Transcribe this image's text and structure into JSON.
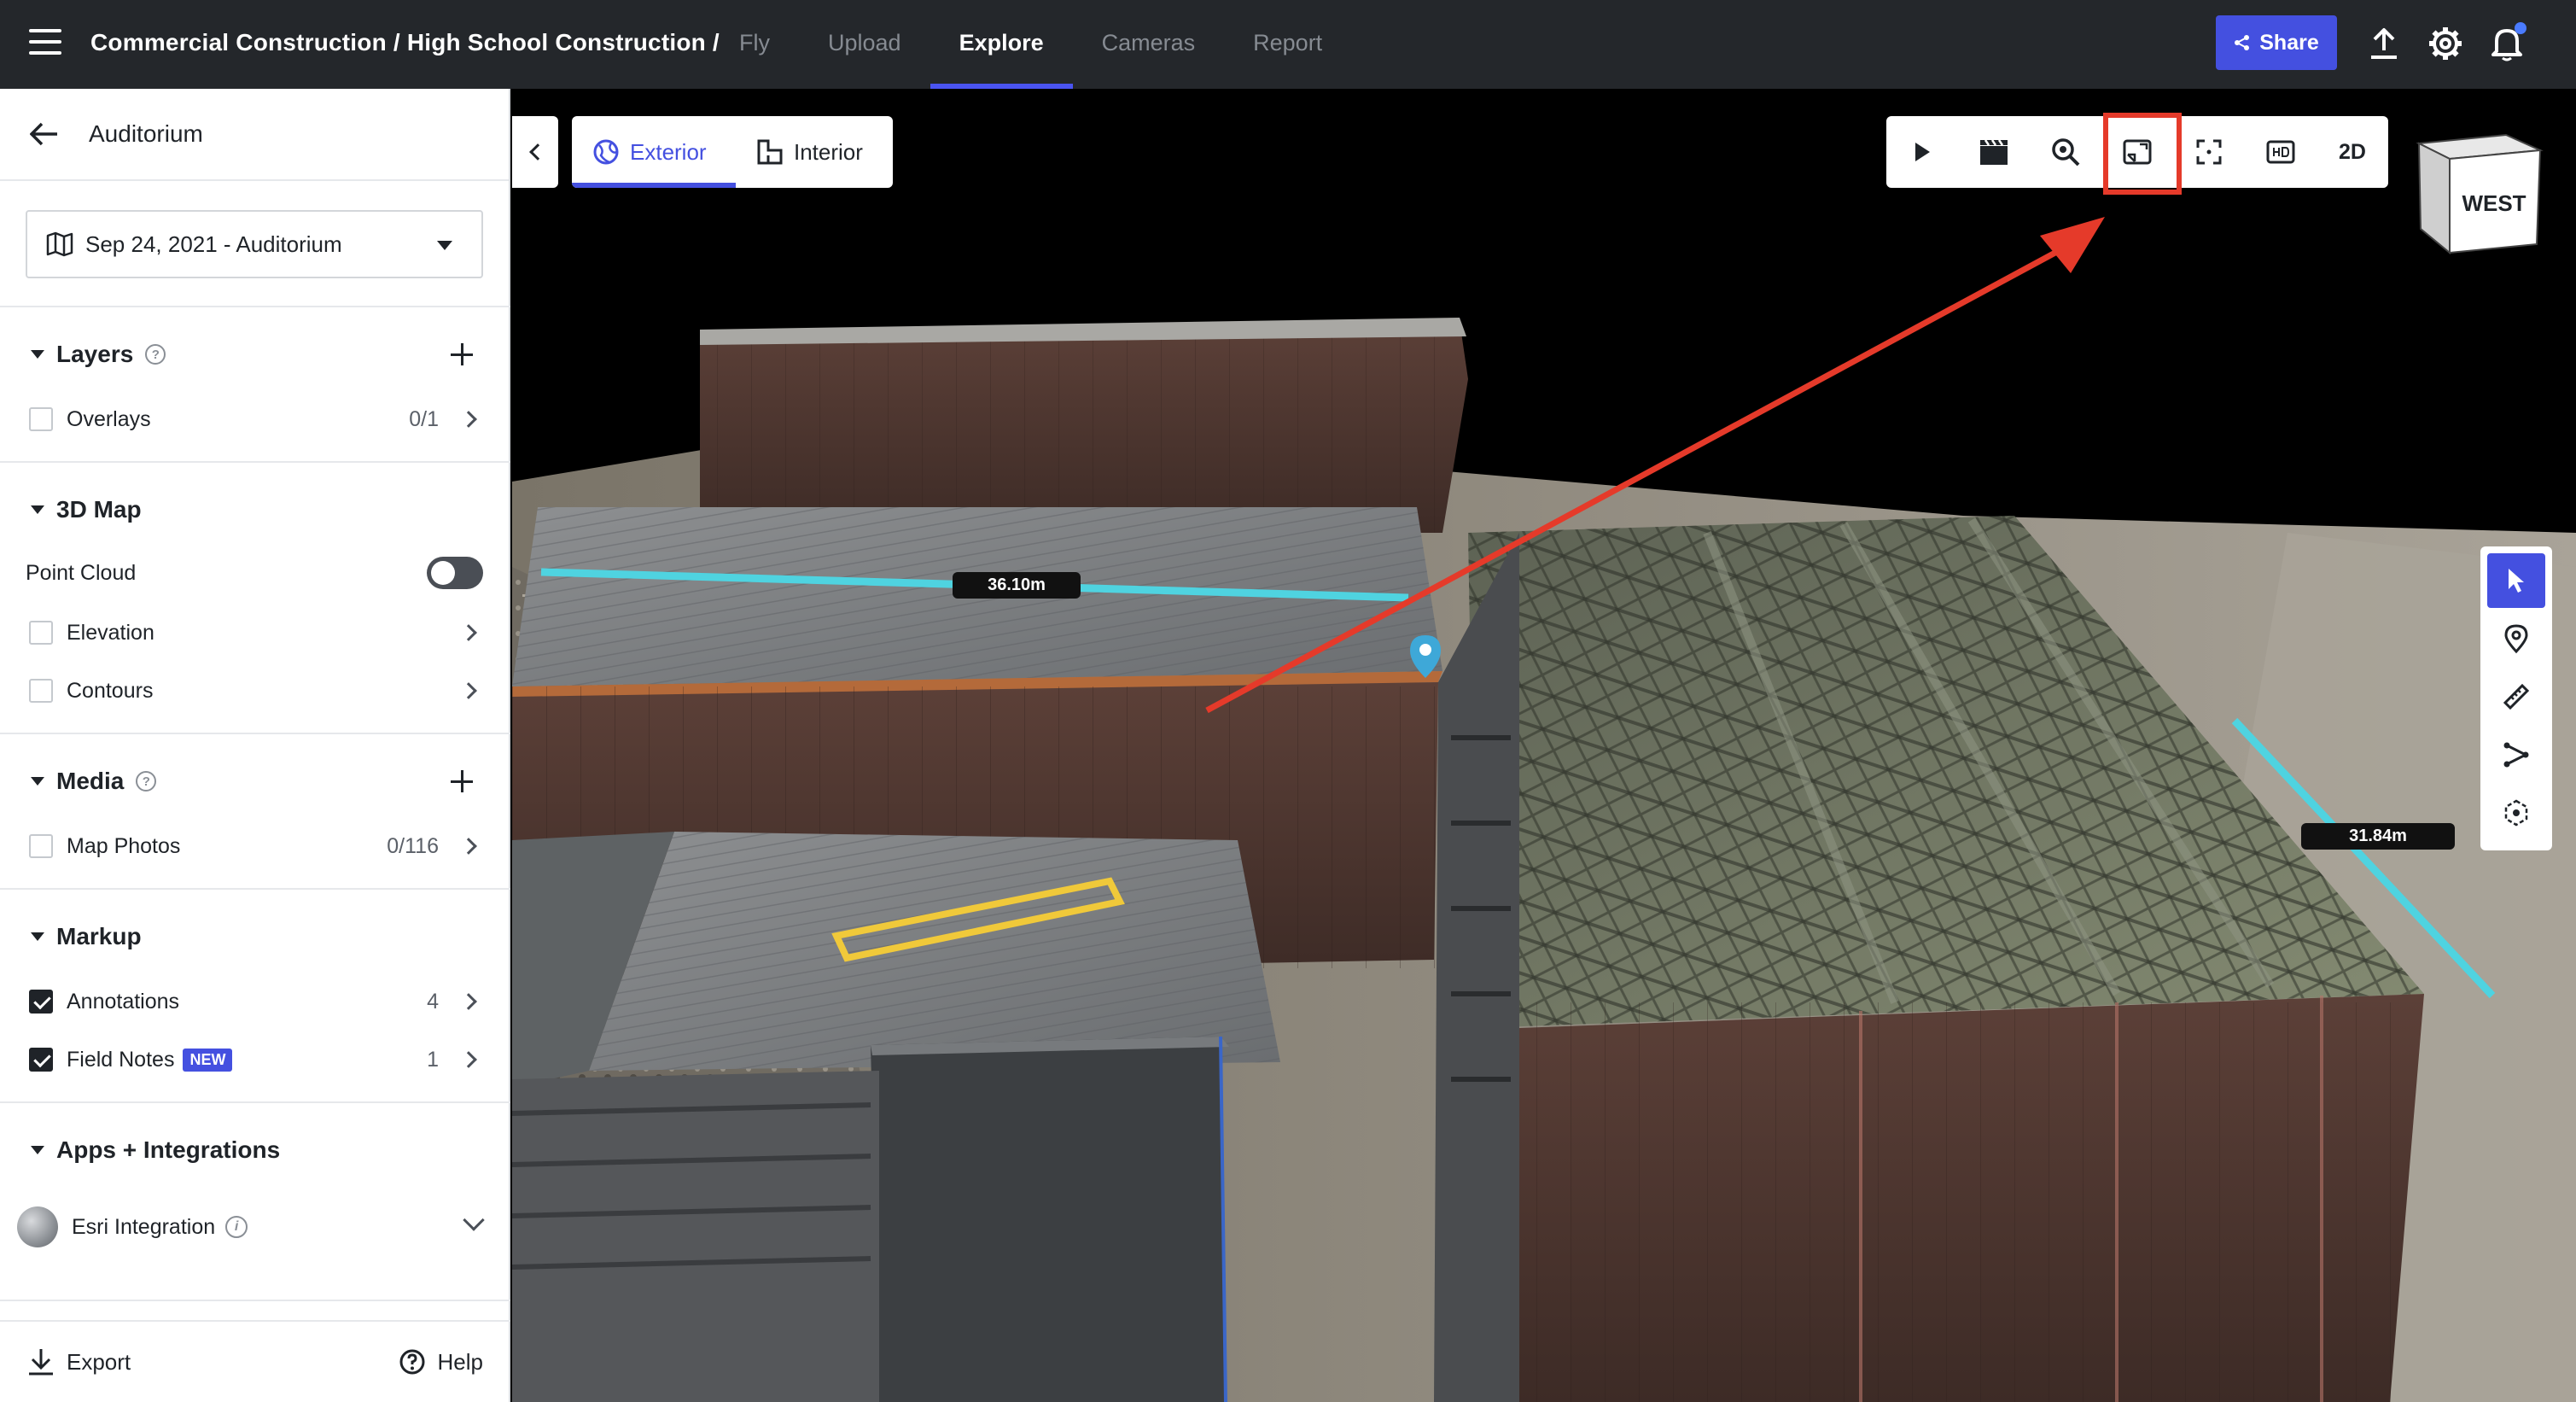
{
  "topbar": {
    "breadcrumb": "Commercial Construction / High School Construction /",
    "tabs": [
      {
        "label": "Fly",
        "active": false
      },
      {
        "label": "Upload",
        "active": false
      },
      {
        "label": "Explore",
        "active": true
      },
      {
        "label": "Cameras",
        "active": false
      },
      {
        "label": "Report",
        "active": false
      }
    ],
    "share_label": "Share",
    "icons": [
      "menu-icon",
      "share-nodes-icon",
      "upload-icon",
      "gear-icon",
      "bell-icon"
    ]
  },
  "sidebar": {
    "title": "Auditorium",
    "date_select": "Sep 24, 2021 - Auditorium",
    "sections": {
      "layers": {
        "label": "Layers",
        "items": [
          {
            "label": "Overlays",
            "count": "0/1",
            "checked": false
          }
        ]
      },
      "map3d": {
        "label": "3D Map",
        "point_cloud": {
          "label": "Point Cloud",
          "enabled": false
        },
        "items": [
          {
            "label": "Elevation",
            "checked": false
          },
          {
            "label": "Contours",
            "checked": false
          }
        ]
      },
      "media": {
        "label": "Media",
        "items": [
          {
            "label": "Map Photos",
            "count": "0/116",
            "checked": false
          }
        ]
      },
      "markup": {
        "label": "Markup",
        "items": [
          {
            "label": "Annotations",
            "count": "4",
            "checked": true
          },
          {
            "label": "Field Notes",
            "count": "1",
            "checked": true,
            "badge": "NEW"
          }
        ]
      },
      "apps": {
        "label": "Apps + Integrations",
        "esri_label": "Esri Integration"
      }
    },
    "footer": {
      "export_label": "Export",
      "help_label": "Help"
    }
  },
  "viewport": {
    "mode_switch": [
      {
        "label": "Exterior",
        "active": true
      },
      {
        "label": "Interior",
        "active": false
      }
    ],
    "toolbar": {
      "buttons": [
        "play-icon",
        "clapperboard-icon",
        "zoom-icon",
        "picture-in-picture-icon",
        "fullscreen-icon",
        "hd-icon"
      ],
      "view_2d_label": "2D",
      "highlighted_button": "picture-in-picture-icon"
    },
    "compass_label": "WEST",
    "right_tools": [
      "pointer-icon",
      "location-pin-icon",
      "ruler-icon",
      "path-icon",
      "volume-icon"
    ],
    "measurements": [
      "36.10m",
      "31.84m"
    ],
    "colors": {
      "accent": "#4450e0",
      "highlight": "#e53a2a",
      "measure_line": "#4fd3e0",
      "annotation_outline": "#f0c93a"
    }
  }
}
